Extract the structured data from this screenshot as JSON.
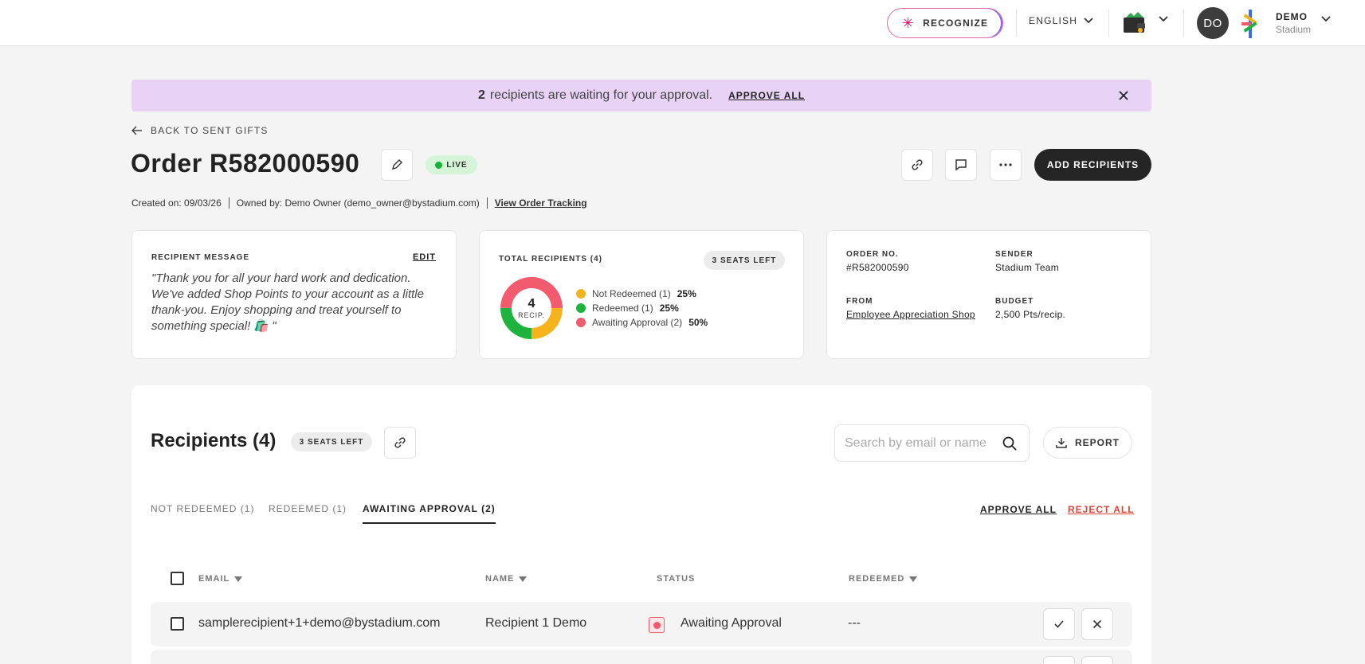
{
  "topbar": {
    "recognize_label": "RECOGNIZE",
    "language": "ENGLISH",
    "avatar_initials": "DO",
    "user_name": "DEMO",
    "user_org": "Stadium"
  },
  "banner": {
    "count": "2",
    "text": "recipients are waiting for your approval.",
    "approve_all": "APPROVE ALL"
  },
  "header": {
    "back_link": "BACK TO SENT GIFTS",
    "order_title": "Order R582000590",
    "live_badge": "LIVE",
    "add_recipients": "ADD RECIPIENTS",
    "created_on": "Created on: 09/03/26",
    "owned_by": "Owned by: Demo Owner (demo_owner@bystadium.com)",
    "tracking_link": "View Order Tracking"
  },
  "recipient_message": {
    "label": "RECIPIENT MESSAGE",
    "edit": "EDIT",
    "message": "\"Thank you for all your hard work and dedication. We've added Shop Points to your account as a little thank-you. Enjoy shopping and treat yourself to something special! 🛍️ \""
  },
  "total_recipients": {
    "label": "TOTAL RECIPIENTS (4)",
    "seats_left": "3 SEATS LEFT",
    "center_value": "4",
    "center_unit": "RECIP.",
    "legend": [
      {
        "label": "Not Redeemed (1)",
        "pct": "25%",
        "color": "#f5b41e",
        "value": 1
      },
      {
        "label": "Redeemed (1)",
        "pct": "25%",
        "color": "#1db33c",
        "value": 1
      },
      {
        "label": "Awaiting Approval (2)",
        "pct": "50%",
        "color": "#f25a6e",
        "value": 2
      }
    ]
  },
  "order_info": {
    "order_no_label": "ORDER NO.",
    "order_no": "#R582000590",
    "sender_label": "SENDER",
    "sender": "Stadium Team",
    "from_label": "FROM",
    "from": "Employee Appreciation Shop",
    "budget_label": "BUDGET",
    "budget": "2,500 Pts/recip."
  },
  "recipients": {
    "title": "Recipients (4)",
    "seats_left": "3 SEATS LEFT",
    "search_placeholder": "Search by email or name",
    "report": "REPORT",
    "tabs": [
      "NOT REDEEMED (1)",
      "REDEEMED (1)",
      "AWAITING APPROVAL (2)"
    ],
    "approve_all": "APPROVE ALL",
    "reject_all": "REJECT ALL",
    "columns": [
      "EMAIL",
      "NAME",
      "STATUS",
      "REDEEMED"
    ],
    "rows": [
      {
        "email": "samplerecipient+1+demo@bystadium.com",
        "name": "Recipient 1 Demo",
        "status": "Awaiting Approval",
        "redeemed": "---"
      }
    ]
  }
}
